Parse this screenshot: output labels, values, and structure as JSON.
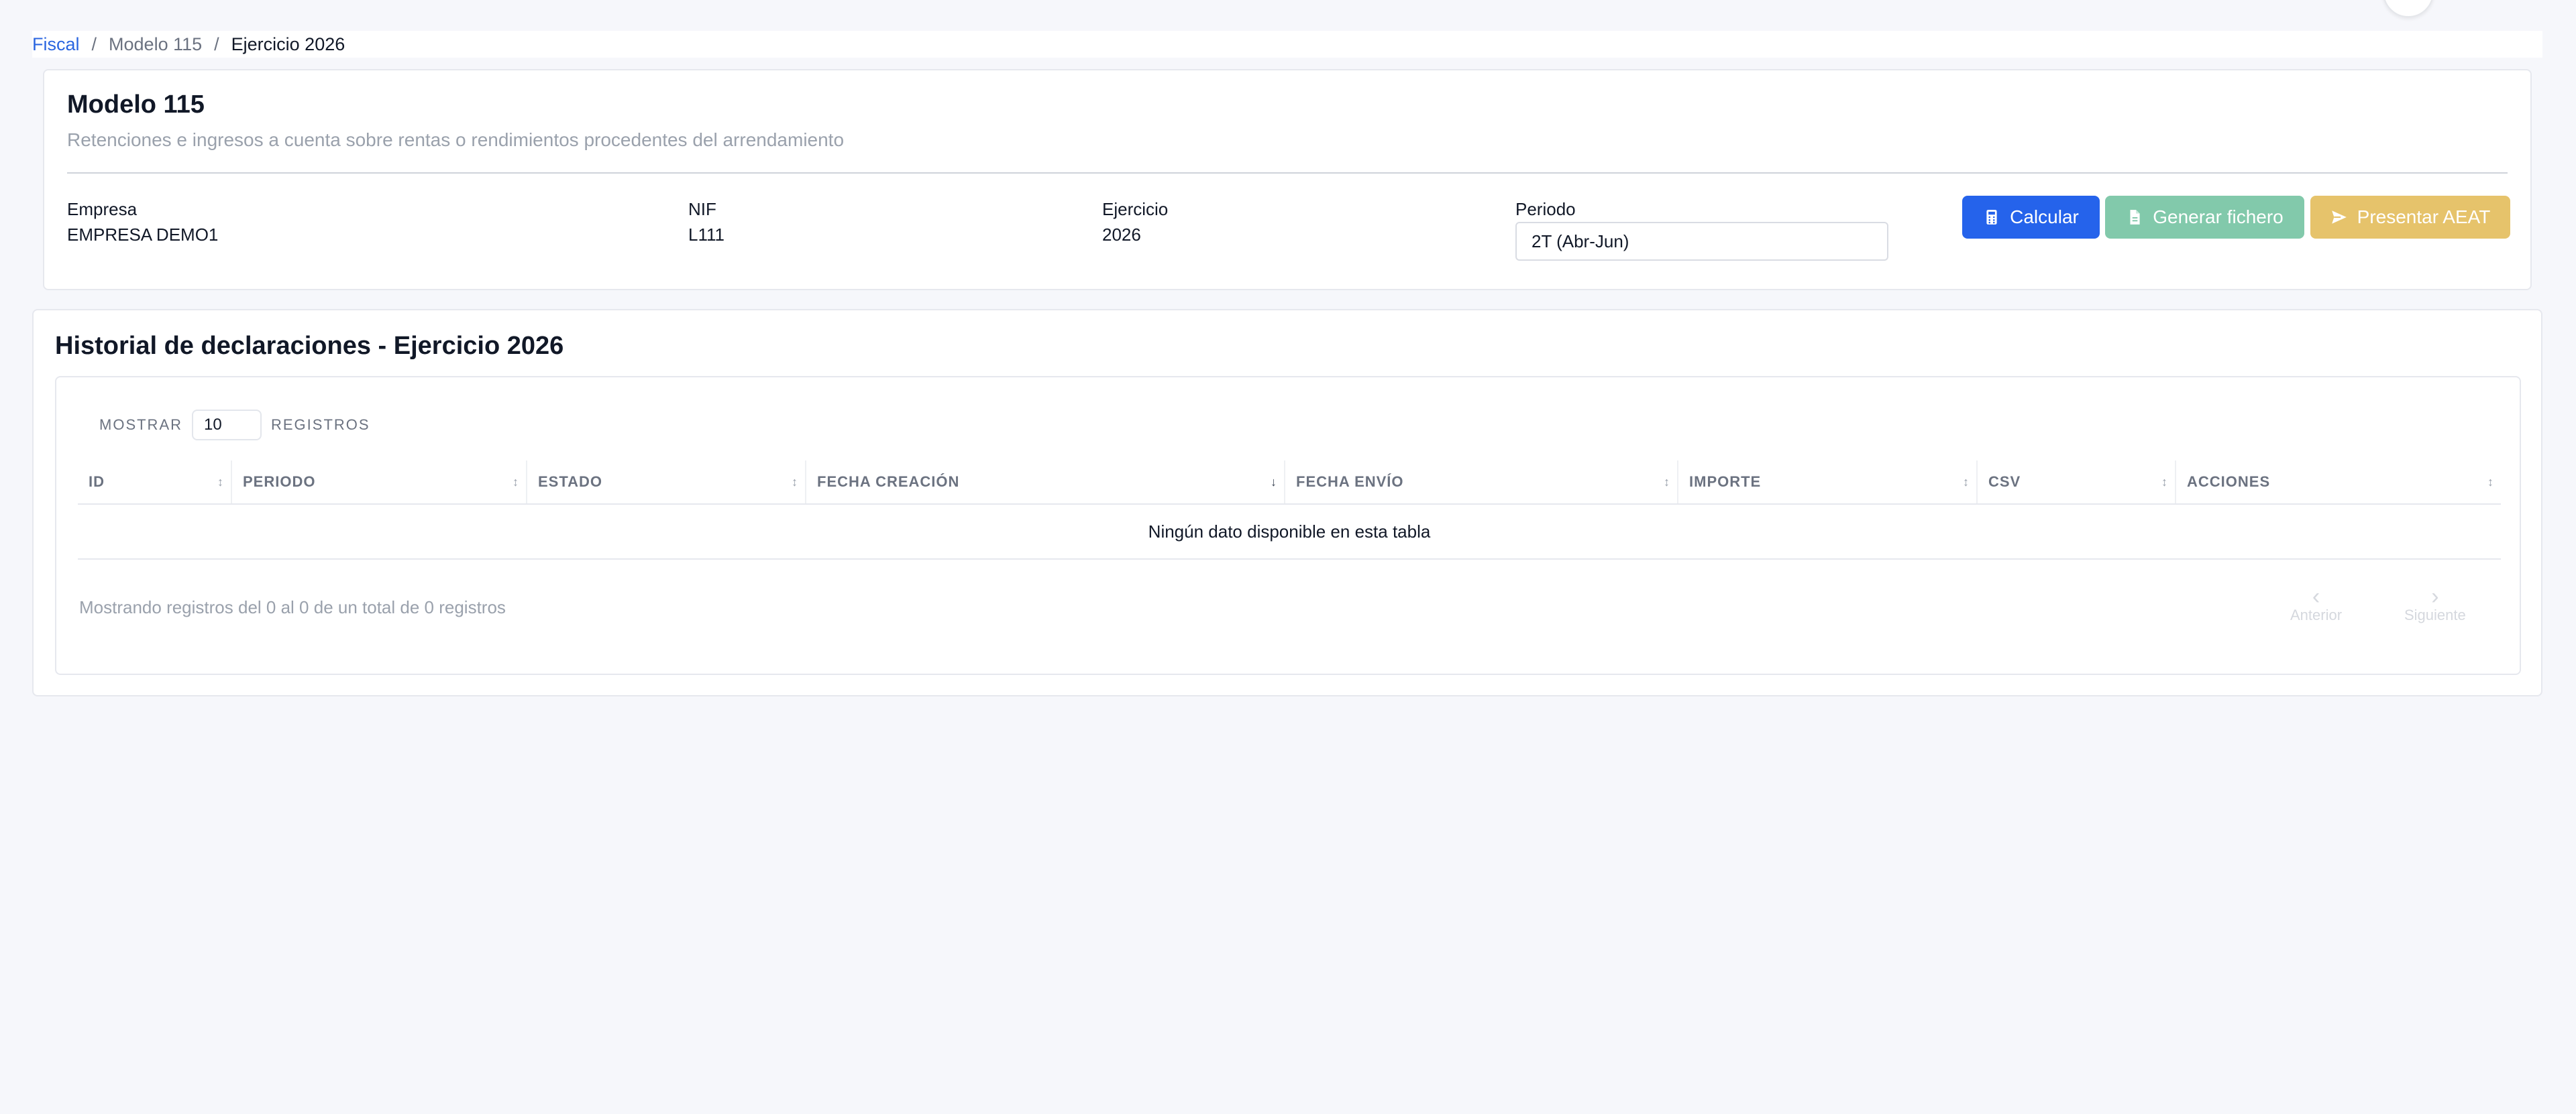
{
  "breadcrumb": {
    "items": [
      "Fiscal",
      "Modelo 115",
      "Ejercicio 2026"
    ],
    "separator": "/"
  },
  "header": {
    "title": "Modelo 115",
    "subtitle": "Retenciones e ingresos a cuenta sobre rentas o rendimientos procedentes del arrendamiento"
  },
  "fields": {
    "empresa_label": "Empresa",
    "empresa_value": "EMPRESA DEMO1",
    "nif_label": "NIF",
    "nif_value": "L111",
    "ejercicio_label": "Ejercicio",
    "ejercicio_value": "2026",
    "periodo_label": "Periodo",
    "periodo_value": "2T (Abr-Jun)"
  },
  "actions": {
    "calcular": "Calcular",
    "generar": "Generar fichero",
    "presentar": "Presentar AEAT"
  },
  "history": {
    "title": "Historial de declaraciones - Ejercicio 2026",
    "show_label": "MOSTRAR",
    "show_value": "10",
    "records_label": "REGISTROS",
    "columns": [
      "ID",
      "PERIODO",
      "ESTADO",
      "FECHA CREACIÓN",
      "FECHA ENVÍO",
      "IMPORTE",
      "CSV",
      "ACCIONES"
    ],
    "empty_message": "Ningún dato disponible en esta tabla",
    "info": "Mostrando registros del 0 al 0 de un total de 0 registros",
    "prev_label": "Anterior",
    "next_label": "Siguiente"
  },
  "colors": {
    "primary": "#2563eb",
    "success_disabled": "#82c9ab",
    "warning_disabled": "#e6c36b",
    "link": "#2b66e0"
  },
  "icons": {
    "calcular": "calculator-icon",
    "generar": "file-icon",
    "presentar": "send-icon"
  }
}
